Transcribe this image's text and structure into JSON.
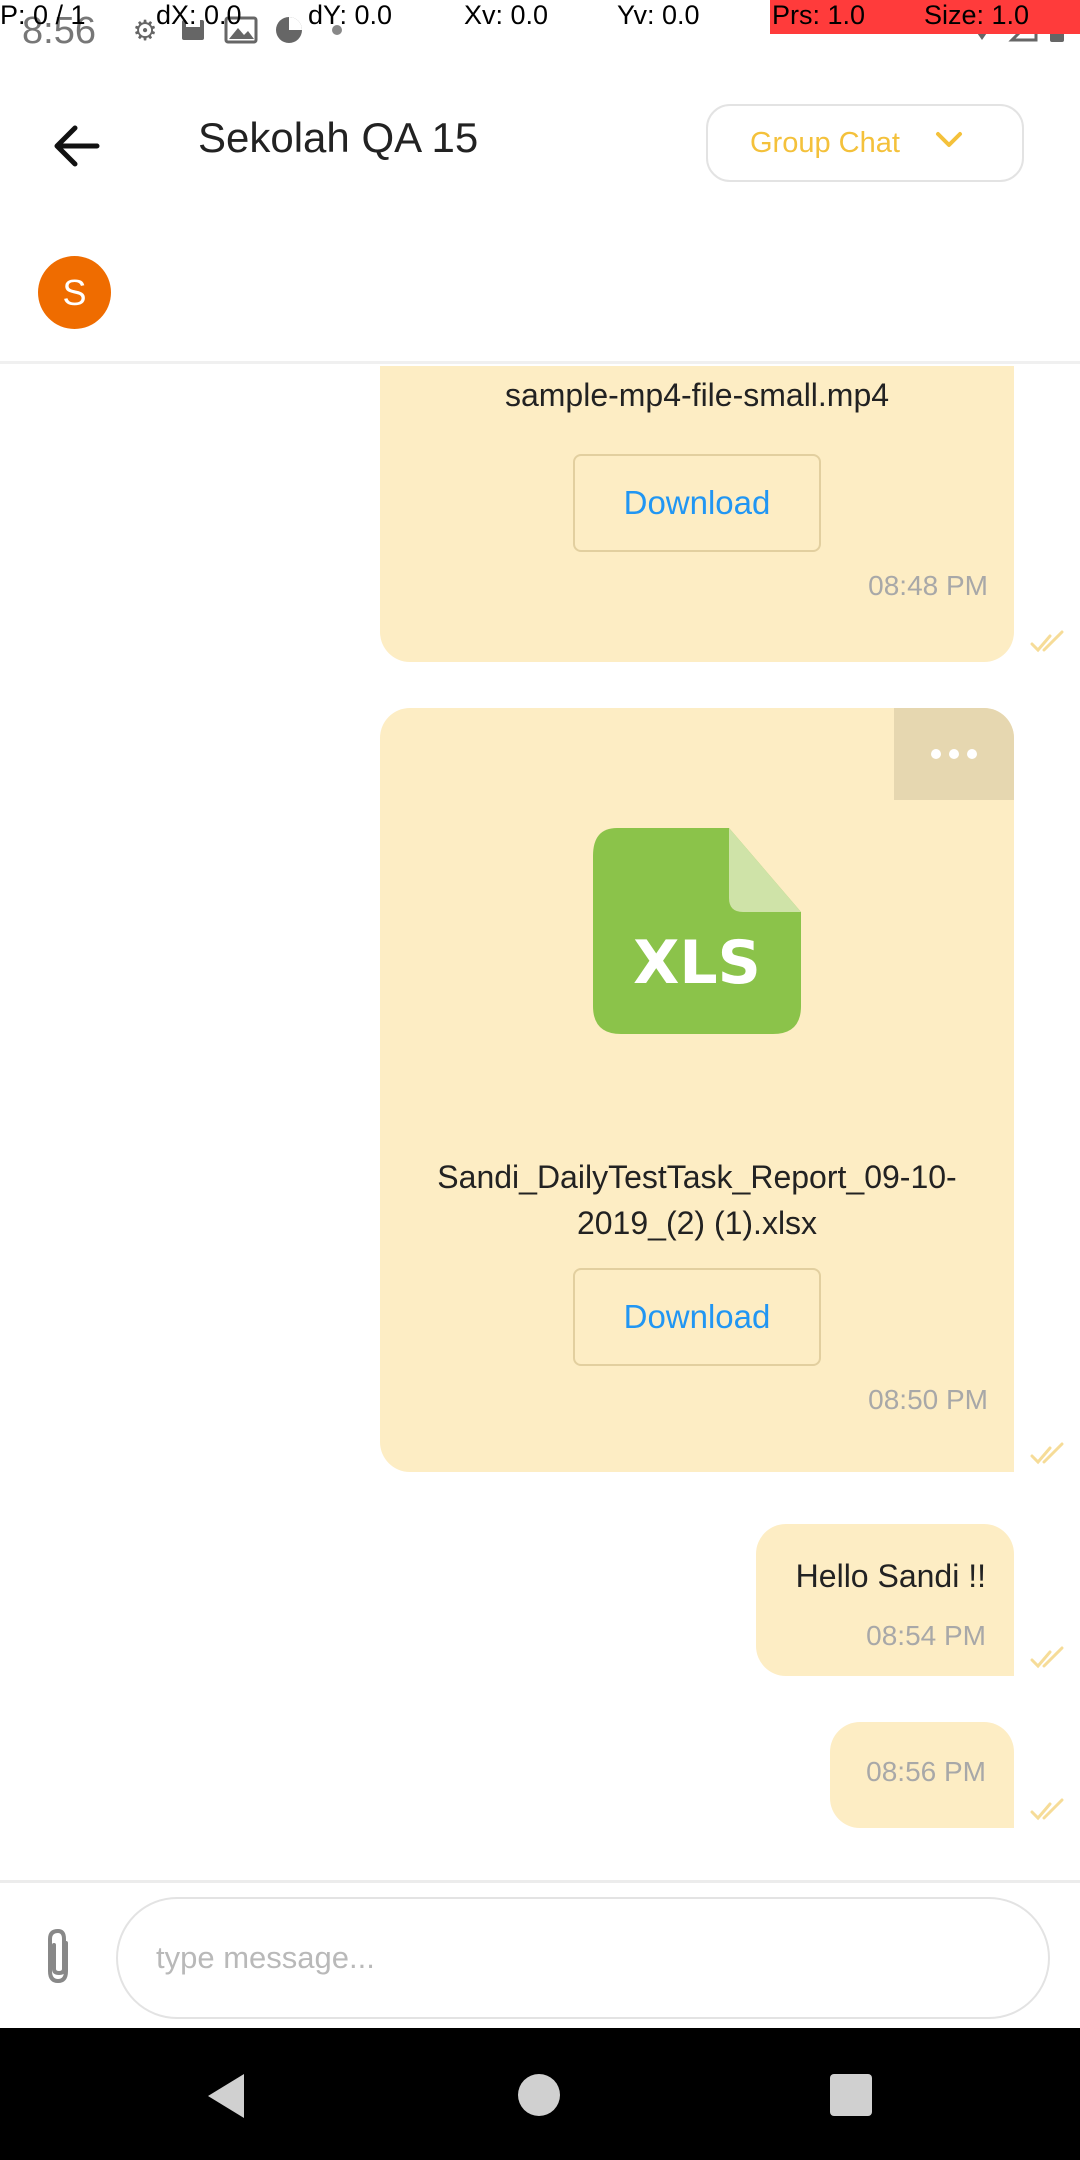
{
  "status_bar": {
    "time": "8:56",
    "debug": {
      "p": "P: 0 / 1",
      "dx": "dX: 0.0",
      "dy": "dY: 0.0",
      "xv": "Xv: 0.0",
      "yv": "Yv: 0.0",
      "prs": "Prs: 1.0",
      "size": "Size: 1.0"
    }
  },
  "header": {
    "title": "Sekolah QA 15",
    "chat_type": "Group Chat",
    "accent_color": "#f4c13b"
  },
  "participants": [
    {
      "initial": "S",
      "color": "#ef6c00"
    }
  ],
  "messages": [
    {
      "type": "file",
      "file_name": "sample-mp4-file-small.mp4",
      "download_label": "Download",
      "time": "08:48 PM"
    },
    {
      "type": "file",
      "file_badge": "XLS",
      "file_name": "Sandi_DailyTestTask_Report_09-10-2019_(2) (1).xlsx",
      "file_name_line1": "Sandi_DailyTestTask_Report_09-10-",
      "file_name_line2": "2019_(2) (1).xlsx",
      "download_label": "Download",
      "time": "08:50 PM"
    },
    {
      "type": "text",
      "text": "Hello Sandi !!",
      "time": "08:54 PM"
    },
    {
      "type": "text",
      "text": "",
      "time": "08:56 PM"
    }
  ],
  "composer": {
    "placeholder": "type message..."
  },
  "colors": {
    "bubble": "#fdedc4",
    "link": "#2196f3",
    "xls_green": "#8bc34a"
  }
}
